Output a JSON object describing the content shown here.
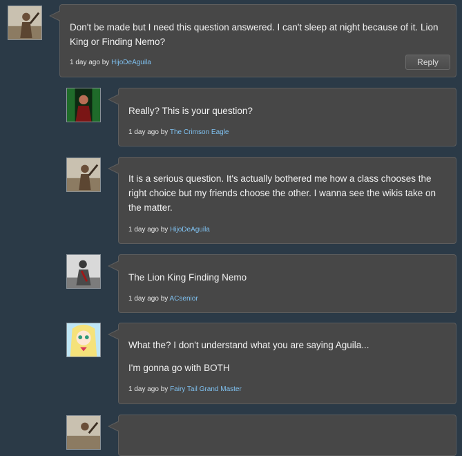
{
  "comments": [
    {
      "paragraphs": [
        "Don't be made but I need this question answered. I can't sleep at night because of it. Lion King or Finding Nemo?"
      ],
      "time": "1 day ago",
      "by": "by",
      "author": "HijoDeAguila",
      "reply": "Reply"
    },
    {
      "paragraphs": [
        "Really? This is your question?"
      ],
      "time": "1 day ago",
      "by": "by",
      "author": "The Crimson Eagle"
    },
    {
      "paragraphs": [
        "It is a serious question. It's actually bothered me how a class chooses the right choice but my friends choose the other. I wanna see the wikis take on the matter."
      ],
      "time": "1 day ago",
      "by": "by",
      "author": "HijoDeAguila"
    },
    {
      "paragraphs": [
        "The Lion King Finding Nemo"
      ],
      "time": "1 day ago",
      "by": "by",
      "author": "ACsenior"
    },
    {
      "paragraphs": [
        "What the? I don't understand what you are saying Aguila...",
        "I'm gonna go with BOTH"
      ],
      "time": "1 day ago",
      "by": "by",
      "author": "Fairy Tail Grand Master"
    }
  ],
  "colors": {
    "background": "#2b3a47",
    "bubble": "#474747",
    "link": "#7fc1f0"
  }
}
